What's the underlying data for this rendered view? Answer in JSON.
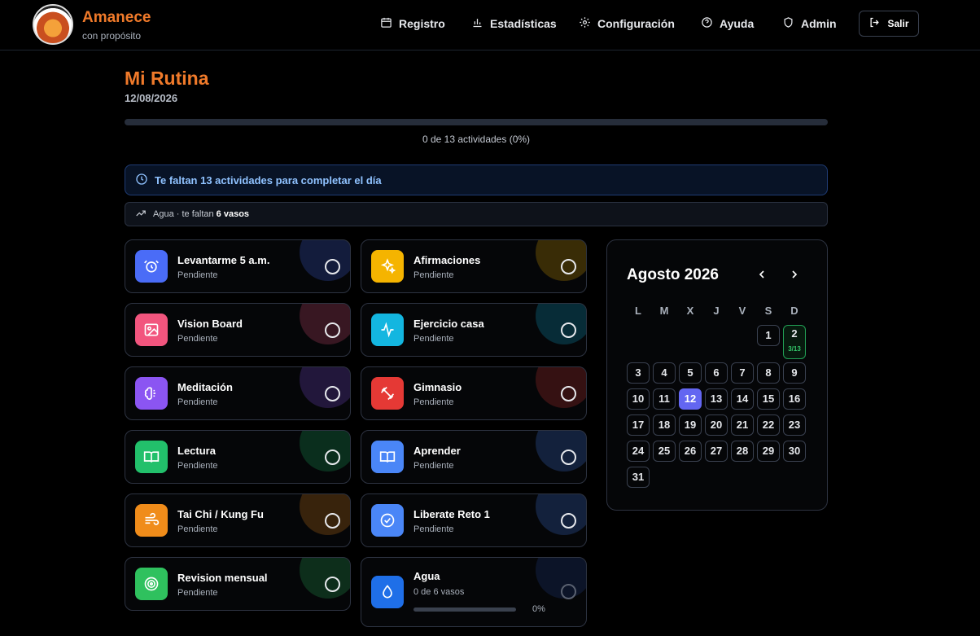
{
  "header": {
    "brand": "Amanece",
    "brand_sub": "con propósito",
    "nav": [
      {
        "label": "Registro",
        "icon": "calendar-icon"
      },
      {
        "label": "Estadísticas",
        "icon": "bar-chart-icon"
      },
      {
        "label": "Configuración",
        "icon": "gear-icon"
      },
      {
        "label": "Ayuda",
        "icon": "help-icon"
      },
      {
        "label": "Admin",
        "icon": "shield-icon"
      }
    ],
    "logout": "Salir"
  },
  "page": {
    "title": "Mi Rutina",
    "date": "12/08/2026",
    "progress": 0,
    "progress_text": "0 de 13 actividades (0%)",
    "alert": "Te faltan 13 actividades para completar el día",
    "water_hint_prefix": "Agua · te faltan ",
    "water_hint_bold": "6 vasos"
  },
  "activities": [
    {
      "title": "Levantarme 5 a.m.",
      "status": "Pendiente",
      "color": "#4a6cf7",
      "icon": "alarm-clock-icon"
    },
    {
      "title": "Afirmaciones",
      "status": "Pendiente",
      "color": "#f5b400",
      "icon": "sparkles-icon"
    },
    {
      "title": "Vision Board",
      "status": "Pendiente",
      "color": "#f2557e",
      "icon": "image-icon"
    },
    {
      "title": "Ejercicio casa",
      "status": "Pendiente",
      "color": "#13b6e0",
      "icon": "activity-icon"
    },
    {
      "title": "Meditación",
      "status": "Pendiente",
      "color": "#8b55f2",
      "icon": "brain-icon"
    },
    {
      "title": "Gimnasio",
      "status": "Pendiente",
      "color": "#e53935",
      "icon": "dumbbell-icon"
    },
    {
      "title": "Lectura",
      "status": "Pendiente",
      "color": "#22c06b",
      "icon": "book-icon"
    },
    {
      "title": "Aprender",
      "status": "Pendiente",
      "color": "#4a86f7",
      "icon": "book-open-icon"
    },
    {
      "title": "Tai Chi / Kung Fu",
      "status": "Pendiente",
      "color": "#f08c1a",
      "icon": "wind-icon"
    },
    {
      "title": "Liberate Reto 1",
      "status": "Pendiente",
      "color": "#4a86f7",
      "icon": "check-circle-icon"
    },
    {
      "title": "Revision mensual",
      "status": "Pendiente",
      "color": "#2fc15e",
      "icon": "target-icon"
    }
  ],
  "water": {
    "title": "Agua",
    "status": "0 de 6 vasos",
    "progress": 0,
    "percent_text": "0%",
    "color": "#1f6fe8",
    "icon": "droplet-icon"
  },
  "calendar": {
    "title": "Agosto 2026",
    "weekdays": [
      "L",
      "M",
      "X",
      "J",
      "V",
      "S",
      "D"
    ],
    "done_label": "3/13",
    "today": 12,
    "done_day": 2
  }
}
